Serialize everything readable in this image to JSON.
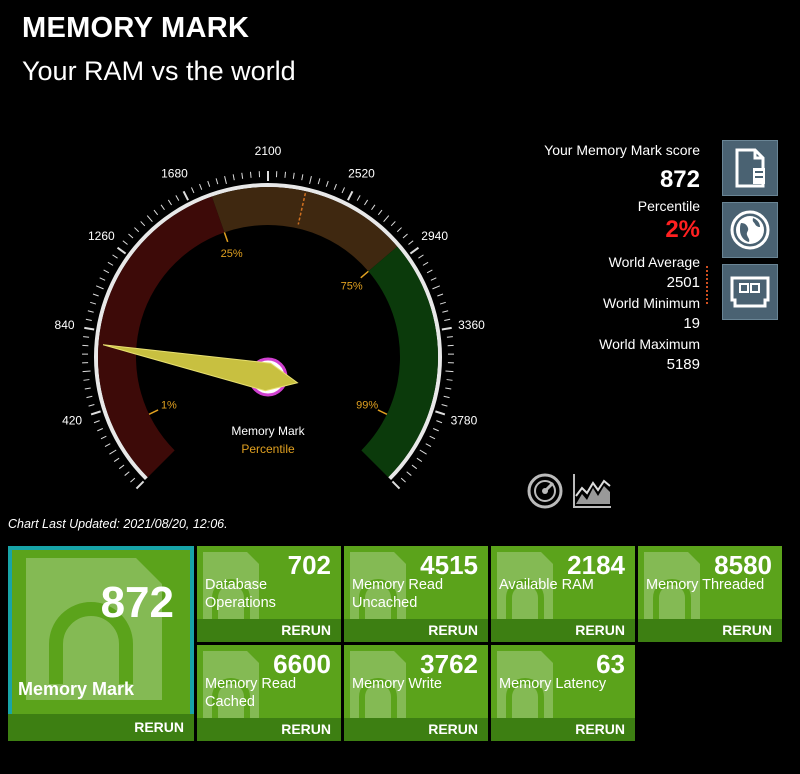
{
  "header": {
    "title": "MEMORY MARK",
    "subtitle": "Your RAM vs the world"
  },
  "gauge": {
    "min": 0,
    "max": 4200,
    "value": 872,
    "ticks": [
      "0",
      "420",
      "840",
      "1260",
      "1680",
      "2100",
      "2520",
      "2940",
      "3360",
      "3780",
      "4200"
    ],
    "percentiles": [
      {
        "label": "1%",
        "value": 300
      },
      {
        "label": "25%",
        "value": 1800
      },
      {
        "label": "75%",
        "value": 2870
      },
      {
        "label": "99%",
        "value": 3900
      }
    ],
    "bands": [
      {
        "from": 0,
        "to": 1800,
        "color": "#3d0a08"
      },
      {
        "from": 1800,
        "to": 2870,
        "color": "#3f2810"
      },
      {
        "from": 2870,
        "to": 4200,
        "color": "#0b3a0b"
      }
    ],
    "center_label": "Memory Mark",
    "center_sublabel": "Percentile"
  },
  "score_panel": {
    "score_label": "Your Memory Mark score",
    "score": "872",
    "percentile_label": "Percentile",
    "percentile": "2%",
    "avg_label": "World Average",
    "avg": "2501",
    "min_label": "World Minimum",
    "min": "19",
    "max_label": "World Maximum",
    "max": "5189"
  },
  "icons": [
    "document-icon",
    "globe-icon",
    "memory-card-icon",
    "speedometer-icon",
    "line-chart-icon"
  ],
  "chart_updated": "Chart Last Updated: 2021/08/20, 12:06.",
  "main_tile": {
    "value": "872",
    "label": "Memory Mark",
    "rerun": "RERUN"
  },
  "tiles": [
    {
      "value": "702",
      "label1": "Database",
      "label2": "Operations",
      "rerun": "RERUN"
    },
    {
      "value": "4515",
      "label1": "Memory Read",
      "label2": "Uncached",
      "rerun": "RERUN"
    },
    {
      "value": "2184",
      "label1": "",
      "label2": "Available RAM",
      "rerun": "RERUN"
    },
    {
      "value": "8580",
      "label1": "",
      "label2": "Memory Threaded",
      "rerun": "RERUN"
    },
    {
      "value": "6600",
      "label1": "Memory Read",
      "label2": "Cached",
      "rerun": "RERUN"
    },
    {
      "value": "3762",
      "label1": "",
      "label2": "Memory Write",
      "rerun": "RERUN"
    },
    {
      "value": "63",
      "label1": "",
      "label2": "Memory Latency",
      "rerun": "RERUN"
    }
  ],
  "colors": {
    "accent_green": "#5ba31b",
    "rerun_bar": "#3d7f12",
    "main_border": "#18a4a8",
    "percentile_red": "#ff2020"
  }
}
